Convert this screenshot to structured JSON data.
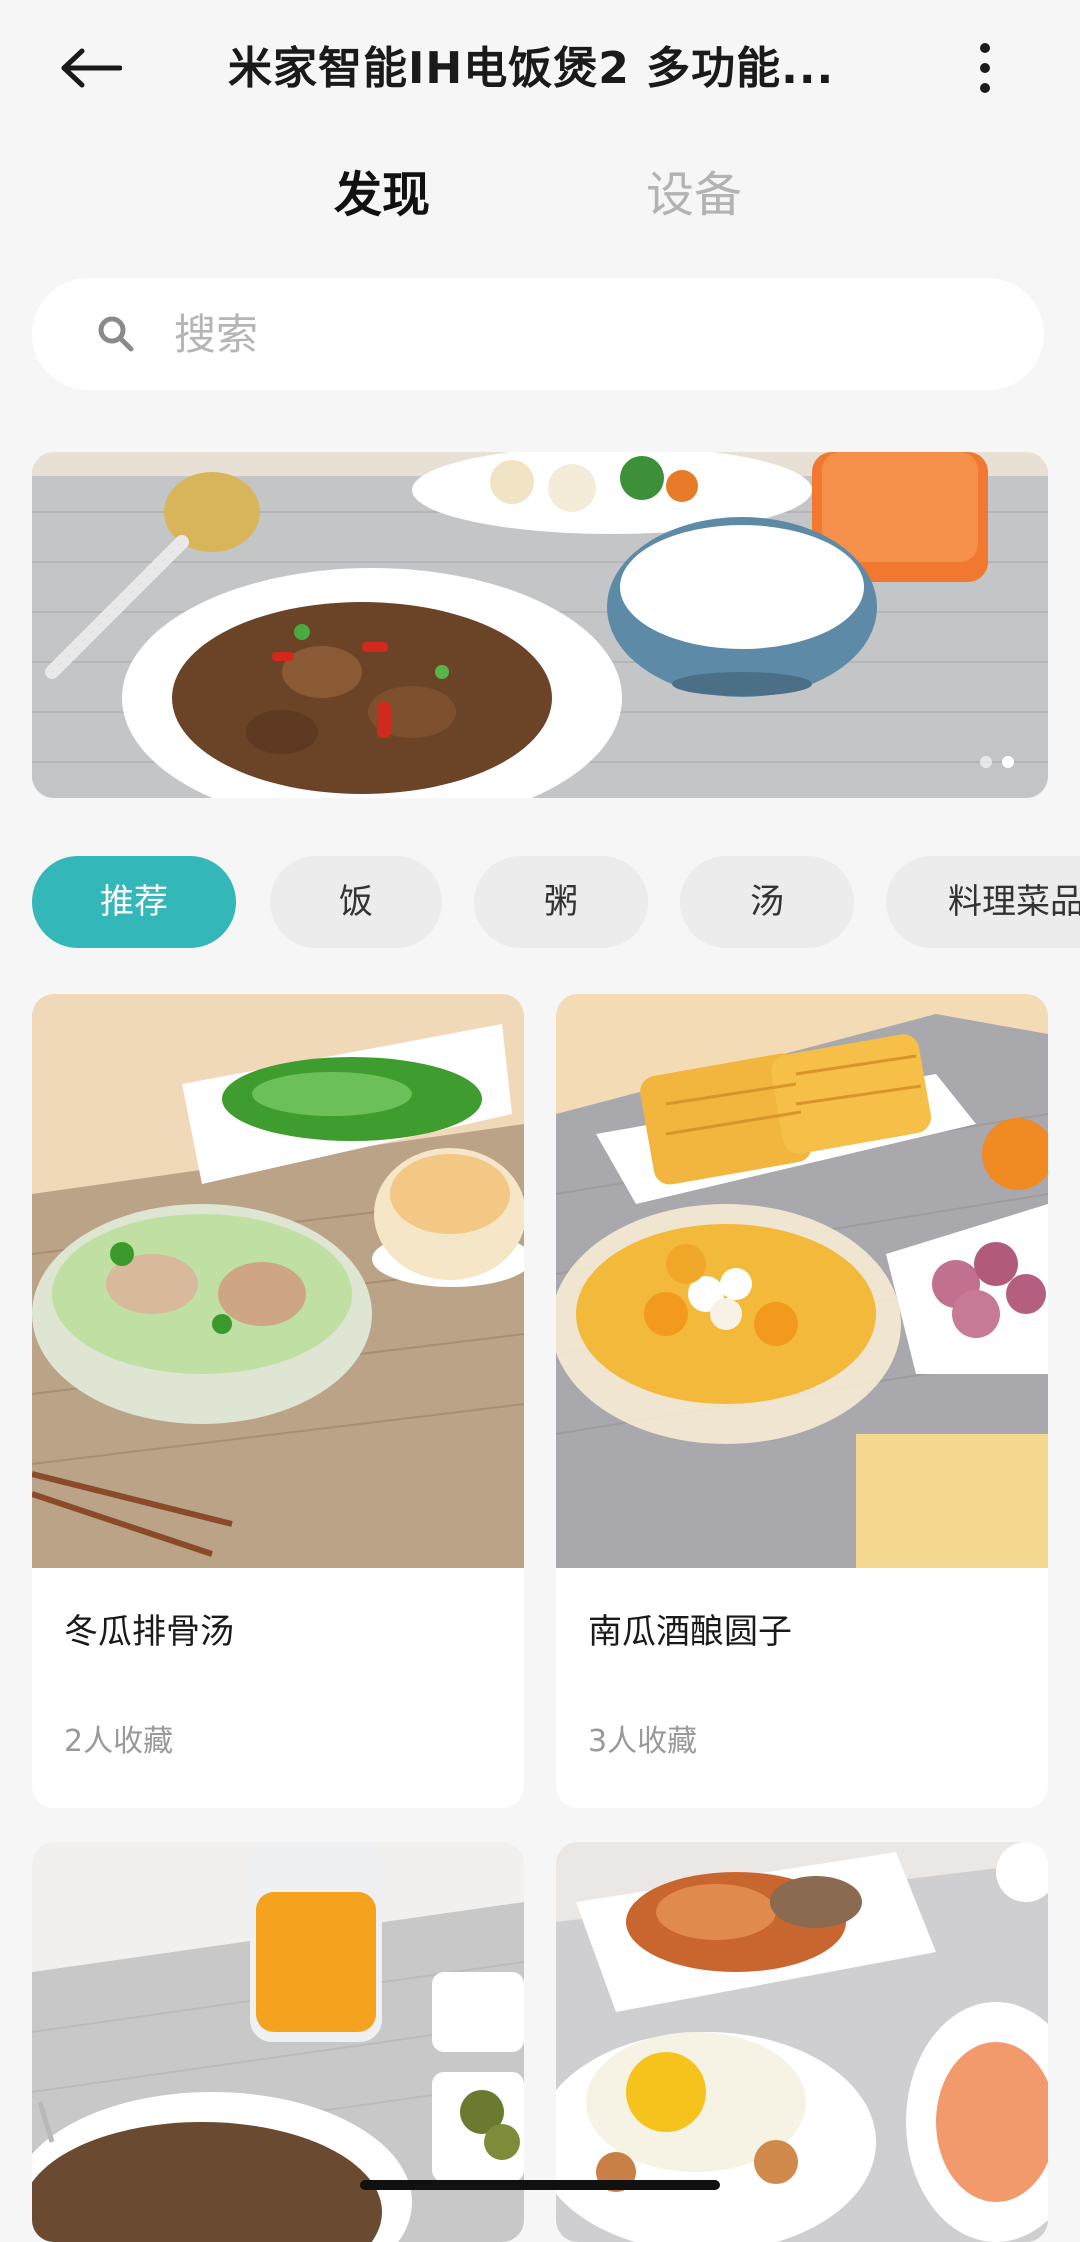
{
  "header": {
    "title": "米家智能IH电饭煲2 多功能...",
    "back_icon": "back-arrow-icon",
    "more_icon": "more-vertical-icon"
  },
  "tabs": [
    {
      "label": "发现",
      "active": true
    },
    {
      "label": "设备",
      "active": false
    }
  ],
  "search": {
    "placeholder": "搜索",
    "icon": "search-icon"
  },
  "banner": {
    "slides": 2,
    "active_slide": 1
  },
  "categories": [
    {
      "label": "推荐",
      "active": true
    },
    {
      "label": "饭",
      "active": false
    },
    {
      "label": "粥",
      "active": false
    },
    {
      "label": "汤",
      "active": false
    },
    {
      "label": "料理菜品",
      "active": false
    }
  ],
  "recipes": [
    {
      "title": "冬瓜排骨汤",
      "favorites": "2人收藏"
    },
    {
      "title": "南瓜酒酿圆子",
      "favorites": "3人收藏"
    }
  ],
  "colors": {
    "accent": "#33b7b9",
    "background": "#f6f6f6",
    "card": "#ffffff"
  }
}
